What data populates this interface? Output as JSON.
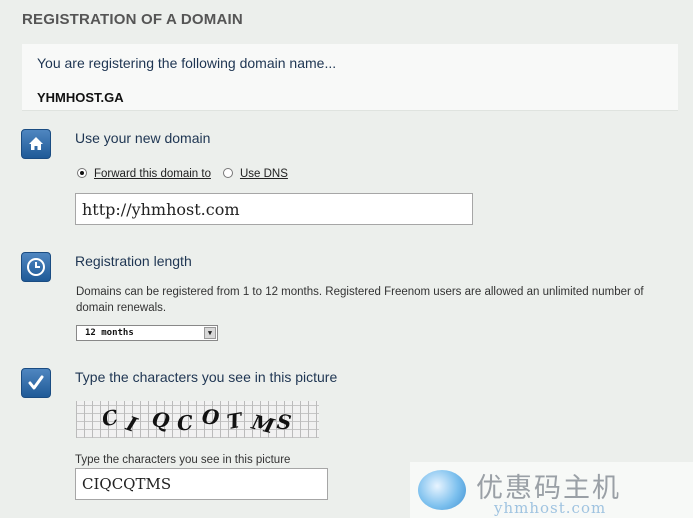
{
  "page": {
    "title": "REGISTRATION OF A DOMAIN"
  },
  "domain_box": {
    "intro": "You are registering the following domain name...",
    "domain_name": "YHMHOST.GA"
  },
  "use_domain": {
    "title": "Use your new domain",
    "icon": "home-icon",
    "options": [
      {
        "label": "Forward this domain to",
        "selected": true
      },
      {
        "label": "Use DNS",
        "selected": false
      }
    ],
    "forward_url": "http://yhmhost.com"
  },
  "registration_length": {
    "title": "Registration length",
    "icon": "clock-icon",
    "description": "Domains can be registered from 1 to 12 months. Registered Freenom users are allowed an unlimited number of domain renewals.",
    "selected": "12 months"
  },
  "captcha": {
    "title": "Type the characters you see in this picture",
    "icon": "checkmark-icon",
    "image_text": "CIQCOTMS",
    "label": "Type the characters you see in this picture",
    "value": "CIQCQTMS"
  },
  "watermark": {
    "cn": "优惠码主机",
    "en": "yhmhost.com"
  },
  "colors": {
    "background": "#ecefec",
    "heading": "#1e3552",
    "icon_blue": "#2a6aab"
  }
}
